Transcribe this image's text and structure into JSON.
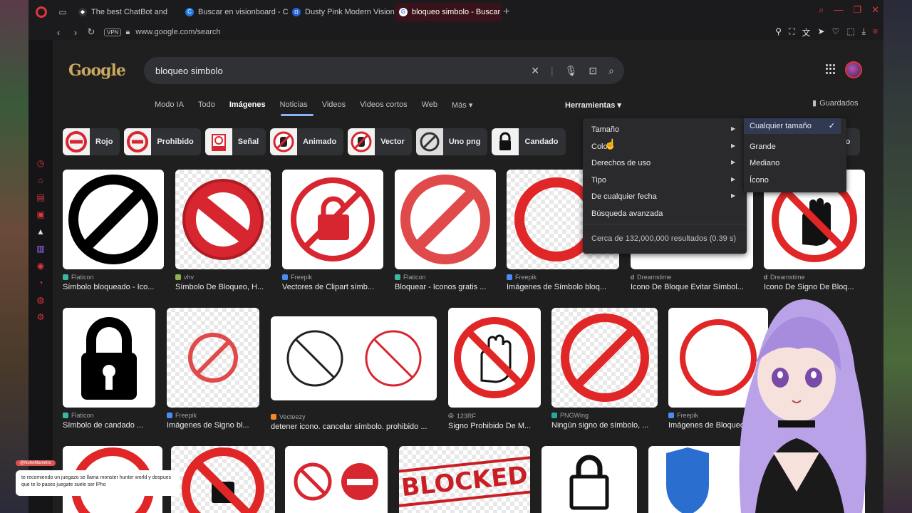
{
  "browser": {
    "tabs": [
      {
        "label": "The best ChatBot and",
        "favicon_color": "#1a1a1a",
        "active": false
      },
      {
        "label": "Buscar en visionboard - C",
        "favicon_color": "#1f7ae0",
        "active": false
      },
      {
        "label": "Dusty Pink Modern Vision",
        "favicon_color": "#2860d8",
        "active": false
      },
      {
        "label": "bloqueo simbolo - Buscar",
        "favicon_color": "#ffffff",
        "active": true
      }
    ],
    "new_tab": "+",
    "address": {
      "vpn": "VPN",
      "url": "www.google.com/search"
    }
  },
  "google": {
    "logo": "Google",
    "query": "bloqueo simbolo",
    "nav_tabs": [
      "Modo IA",
      "Todo",
      "Imágenes",
      "Noticias",
      "Videos",
      "Videos cortos",
      "Web",
      "Más ▾"
    ],
    "active_tab": "Imágenes",
    "tools": "Herramientas ▾",
    "saved": "Guardados",
    "chips": [
      "Rojo",
      "Prohibido",
      "Señal",
      "Animado",
      "Vector",
      "Uno png",
      "Candado"
    ],
    "chip_last": "Icono",
    "tools_menu": {
      "items": [
        "Tamaño",
        "Color",
        "Derechos de uso",
        "Tipo",
        "De cualquier fecha",
        "Búsqueda avanzada"
      ],
      "results": "Cerca de 132,000,000 resultados (0.39 s)"
    },
    "size_submenu": {
      "items": [
        "Cualquier tamaño",
        "Grande",
        "Mediano",
        "Ícono"
      ],
      "selected": "Cualquier tamaño"
    },
    "row1": [
      {
        "source": "Flaticon",
        "title": "Símbolo bloqueado - Ico..."
      },
      {
        "source": "vhv",
        "title": "Símbolo De Bloqueo, H..."
      },
      {
        "source": "Freepik",
        "title": "Vectores de Clipart símb..."
      },
      {
        "source": "Flaticon",
        "title": "Bloquear - Iconos gratis ..."
      },
      {
        "source": "Freepik",
        "title": "Imágenes de Símbolo bloq..."
      },
      {
        "source": "Dreamstime",
        "title": "Icono De Bloque Evitar Símbol..."
      },
      {
        "source": "Dreamstime",
        "title": "Icono De Signo De Bloq..."
      }
    ],
    "row2": [
      {
        "source": "Flaticon",
        "title": "Símbolo de candado ..."
      },
      {
        "source": "Freepik",
        "title": "Imágenes de Signo bl..."
      },
      {
        "source": "Vecteezy",
        "title": "detener icono. cancelar símbolo. prohibido ..."
      },
      {
        "source": "123RF",
        "title": "Signo Prohibido De M..."
      },
      {
        "source": "PNGWing",
        "title": "Ningún signo de símbolo, ..."
      },
      {
        "source": "Freepik",
        "title": "Imágenes de Bloqueo"
      }
    ],
    "row3_label": "BLOCKED"
  },
  "chat": {
    "user": "@NoheMamelro",
    "message": "te recomiendo un juegazo se llama monster hunter world y despues que te lo pases juegate suele ser lPho"
  },
  "colors": {
    "accent": "#e0353b",
    "page_bg": "#1f1f1f",
    "chip_bg": "#303134",
    "sign_red": "#d7262f"
  }
}
